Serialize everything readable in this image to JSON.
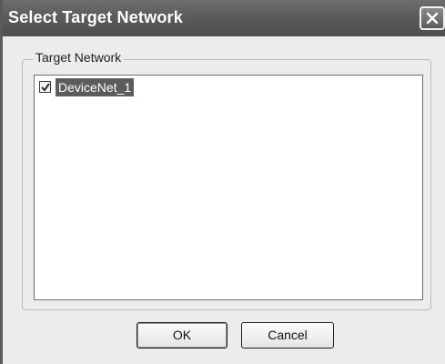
{
  "window": {
    "title": "Select Target Network",
    "close_icon": "close-icon"
  },
  "group": {
    "label": "Target Network",
    "items": [
      {
        "label": "DeviceNet_1",
        "checked": true,
        "selected": true
      }
    ]
  },
  "buttons": {
    "ok_label": "OK",
    "cancel_label": "Cancel"
  }
}
